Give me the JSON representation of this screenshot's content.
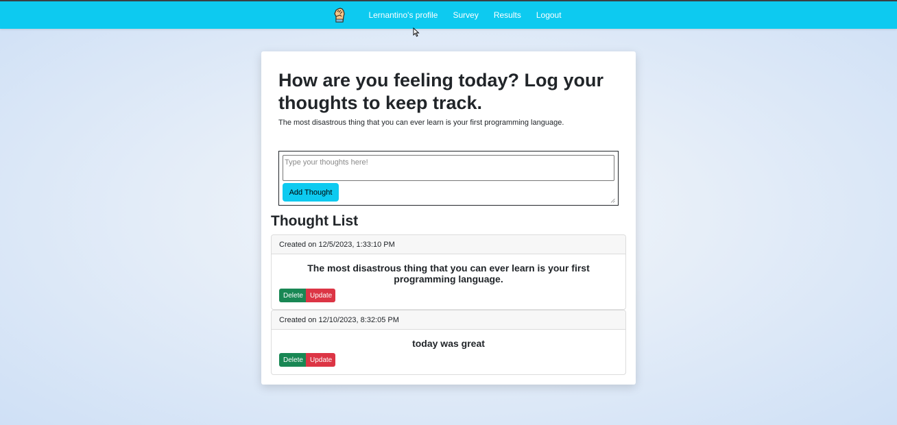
{
  "nav": {
    "brand_icon": "fist-icon",
    "links": [
      "Lernantino's profile",
      "Survey",
      "Results",
      "Logout"
    ]
  },
  "main": {
    "title": "How are you feeling today? Log your thoughts to keep track.",
    "subtitle": "The most disastrous thing that you can ever learn is your first programming language.",
    "form": {
      "placeholder": "Type your thoughts here!",
      "value": "",
      "add_button": "Add Thought"
    },
    "list_heading": "Thought List",
    "thoughts": [
      {
        "created": "Created on 12/5/2023, 1:33:10 PM",
        "text": "The most disastrous thing that you can ever learn is your first programming language.",
        "delete_label": "Delete",
        "update_label": "Update"
      },
      {
        "created": "Created on 12/10/2023, 8:32:05 PM",
        "text": "today was great",
        "delete_label": "Delete",
        "update_label": "Update"
      }
    ]
  },
  "colors": {
    "navbar": "#0dcaf0",
    "delete": "#198754",
    "update": "#dc3545",
    "add_button": "#0dcaf0"
  }
}
